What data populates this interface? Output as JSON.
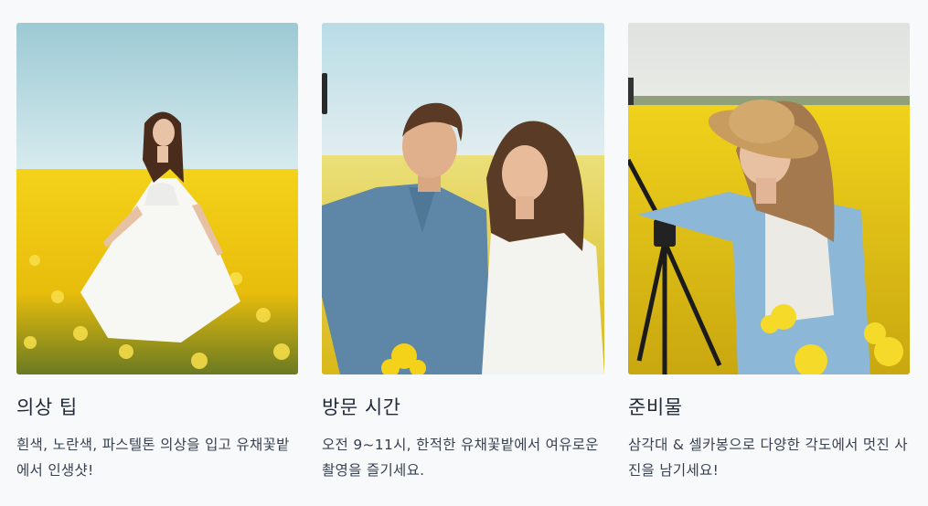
{
  "cards": [
    {
      "image_alt": "노란 유채꽃밭에 흰 원피스를 입은 여성",
      "title": "의상 팁",
      "description": "흰색, 노란색, 파스텔톤 의상을 입고 유채꽃밭에서 인생샷!"
    },
    {
      "image_alt": "유채꽃밭에서 셀카를 찍는 커플",
      "title": "방문 시간",
      "description": "오전 9~11시, 한적한 유채꽃밭에서 여유로운 촬영을 즐기세요."
    },
    {
      "image_alt": "밀짚모자를 쓰고 삼각대와 함께 사진을 찍는 여성",
      "title": "준비물",
      "description": "삼각대 & 셀카봉으로 다양한 각도에서 멋진 사진을 남기세요!"
    }
  ],
  "colors": {
    "sky": "#a9d3de",
    "field": "#f2c915",
    "foliage": "#4a6b2a",
    "page_bg": "#f8f9fb"
  }
}
